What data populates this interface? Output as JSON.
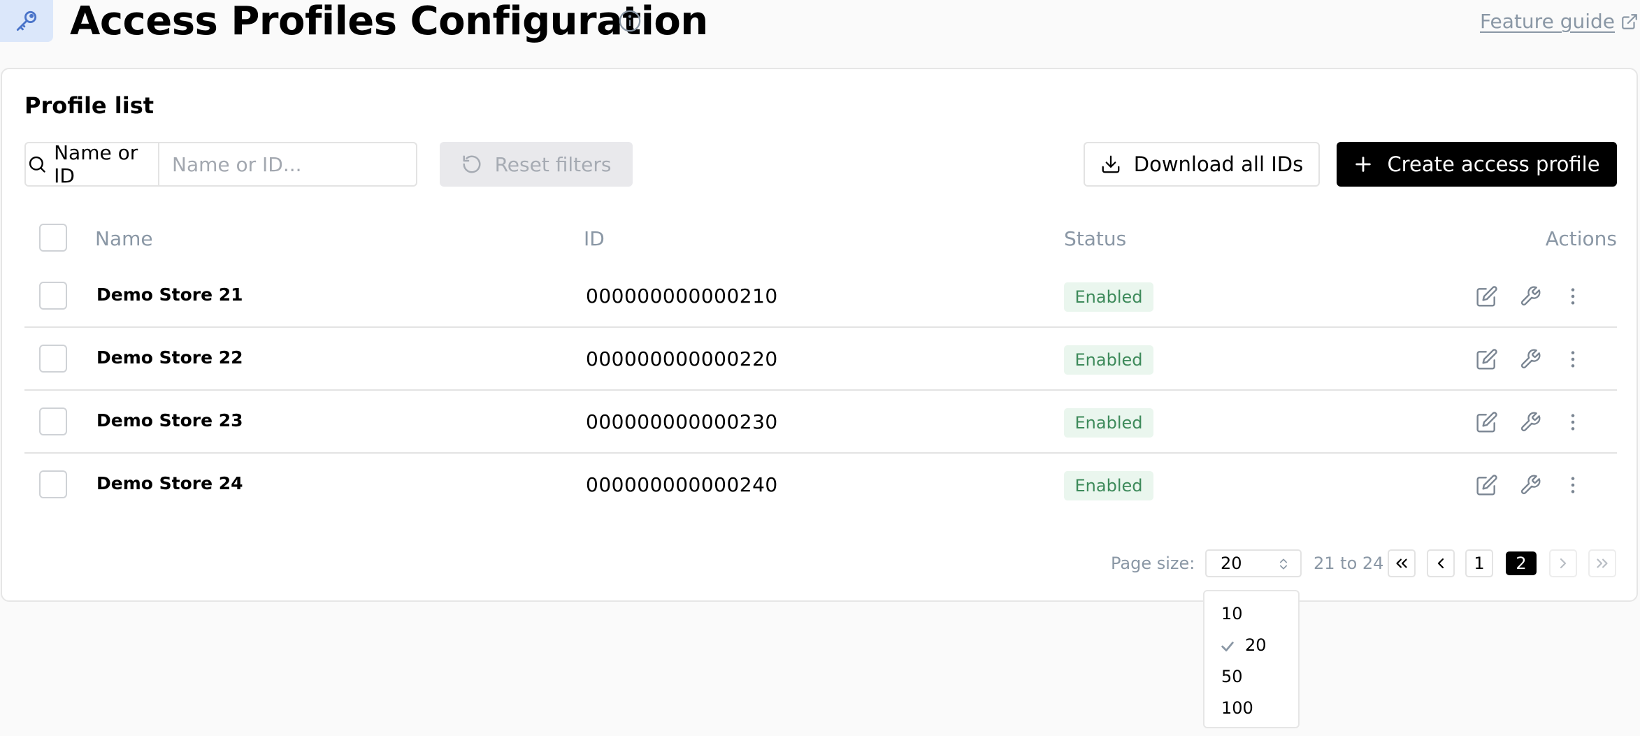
{
  "header": {
    "title": "Access Profiles Configuration",
    "feature_guide": "Feature guide",
    "app_icon": "key-icon",
    "accent_color": "#dbe7fa"
  },
  "card": {
    "title": "Profile list"
  },
  "filters": {
    "search_label": "Name or ID",
    "search_placeholder": "Name or ID...",
    "search_value": "",
    "reset_label": "Reset filters",
    "download_label": "Download all IDs",
    "create_label": "Create access profile"
  },
  "table": {
    "columns": {
      "name": "Name",
      "id": "ID",
      "status": "Status",
      "actions": "Actions"
    },
    "rows": [
      {
        "name": "Demo Store 21",
        "id": "000000000000210",
        "status": "Enabled"
      },
      {
        "name": "Demo Store 22",
        "id": "000000000000220",
        "status": "Enabled"
      },
      {
        "name": "Demo Store 23",
        "id": "000000000000230",
        "status": "Enabled"
      },
      {
        "name": "Demo Store 24",
        "id": "000000000000240",
        "status": "Enabled"
      }
    ],
    "status_color": "#3d8a5a"
  },
  "pagination": {
    "page_size_label": "Page size:",
    "page_size": "20",
    "range": "21 to 24",
    "pages": [
      "1",
      "2"
    ],
    "current_page": "2",
    "page_size_options": [
      "10",
      "20",
      "50",
      "100"
    ]
  }
}
